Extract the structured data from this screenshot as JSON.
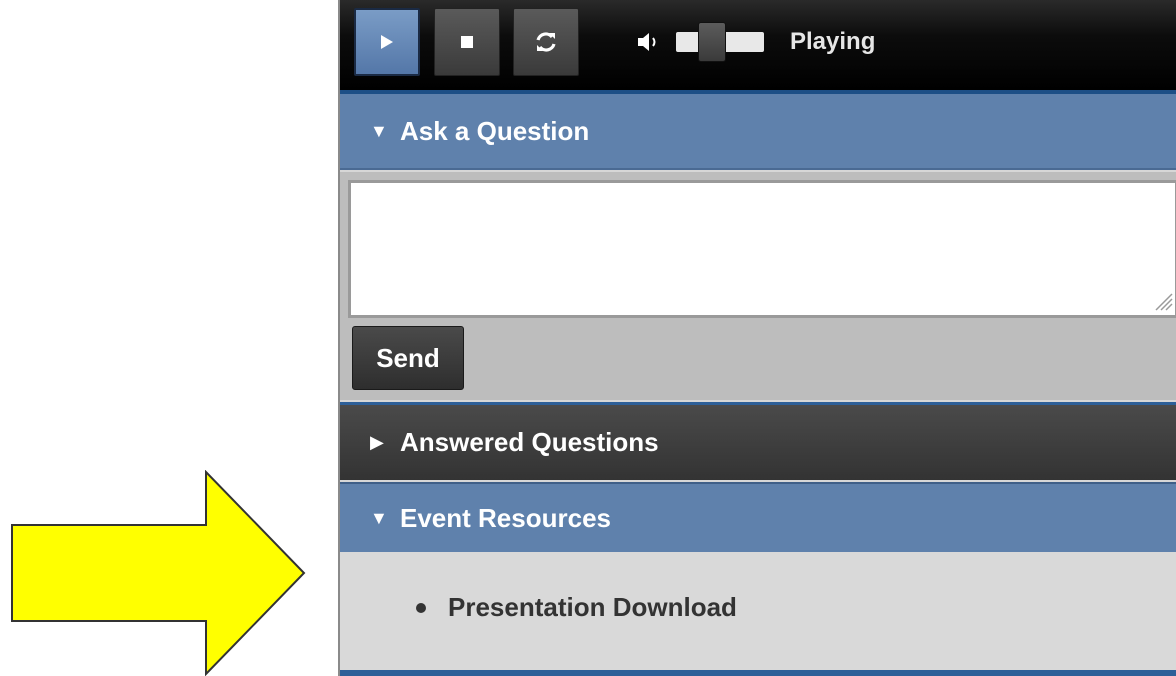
{
  "player": {
    "status_text": "Playing",
    "buttons": {
      "play_icon": "play-icon",
      "stop_icon": "stop-icon",
      "refresh_icon": "refresh-icon"
    },
    "volume_icon": "speaker-icon",
    "volume_level": 0.3
  },
  "ask_question": {
    "header": "Ask a Question",
    "expanded": true,
    "question_value": "",
    "send_label": "Send"
  },
  "answered_questions": {
    "header": "Answered Questions",
    "expanded": false
  },
  "event_resources": {
    "header": "Event Resources",
    "expanded": true,
    "items": [
      {
        "label": "Presentation Download"
      }
    ]
  },
  "annotation": {
    "arrow_color": "#ffff00",
    "arrow_outline": "#333333"
  },
  "colors": {
    "accordion_active": "#5f81ac",
    "accordion_inactive": "#3d3d3d",
    "accent_border": "#2d5f98"
  }
}
